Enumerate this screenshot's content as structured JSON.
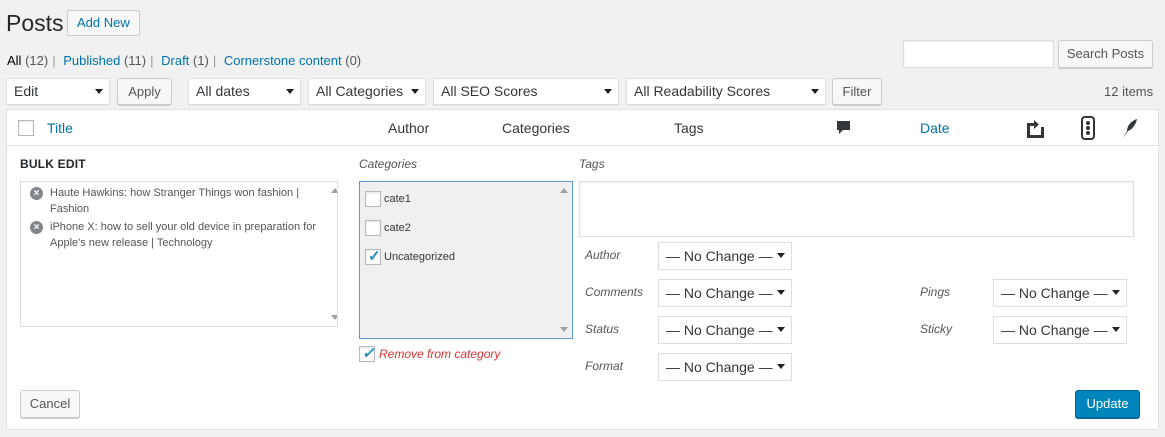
{
  "header": {
    "title": "Posts",
    "add_new": "Add New"
  },
  "views": [
    {
      "label": "All",
      "count": "(12)"
    },
    {
      "label": "Published",
      "count": "(11)"
    },
    {
      "label": "Draft",
      "count": "(1)"
    },
    {
      "label": "Cornerstone content",
      "count": "(0)"
    }
  ],
  "search": {
    "value": "",
    "button": "Search Posts"
  },
  "filters": {
    "bulk_action": "Edit",
    "apply": "Apply",
    "dates": "All dates",
    "categories": "All Categories",
    "seo": "All SEO Scores",
    "readability": "All Readability Scores",
    "filter": "Filter"
  },
  "items_count": "12 items",
  "columns": {
    "title": "Title",
    "author": "Author",
    "categories": "Categories",
    "tags": "Tags",
    "comments_icon": "comment-bubble-icon",
    "date": "Date",
    "seo_icon": "seo-score-icon",
    "readability_icon": "readability-icon",
    "feather_icon": "feather-icon"
  },
  "bulk_edit": {
    "title": "BULK EDIT",
    "posts": [
      "Haute Hawkins: how Stranger Things won fashion | Fashion",
      "iPhone X: how to sell your old device in preparation for Apple's new release | Technology"
    ],
    "categories_label": "Categories",
    "categories": [
      {
        "name": "cate1",
        "checked": false
      },
      {
        "name": "cate2",
        "checked": false
      },
      {
        "name": "Uncategorized",
        "checked": true
      }
    ],
    "remove_from_category": "Remove from category",
    "remove_checked": true,
    "tags_label": "Tags",
    "tags_value": "",
    "fields": {
      "author_label": "Author",
      "author_value": "— No Change —",
      "comments_label": "Comments",
      "comments_value": "— No Change —",
      "status_label": "Status",
      "status_value": "— No Change —",
      "format_label": "Format",
      "format_value": "— No Change —",
      "pings_label": "Pings",
      "pings_value": "— No Change —",
      "sticky_label": "Sticky",
      "sticky_value": "— No Change —"
    },
    "cancel": "Cancel",
    "update": "Update"
  },
  "colors": {
    "link": "#0073aa",
    "primary": "#0085ba",
    "remove": "#dc3232"
  }
}
